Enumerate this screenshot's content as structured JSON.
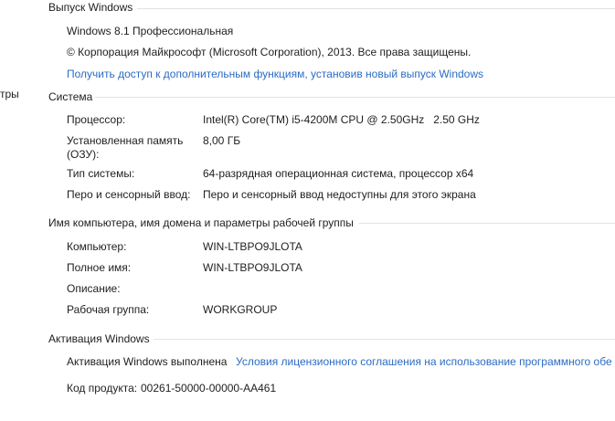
{
  "left_panel": {
    "partial_text": "тры"
  },
  "edition": {
    "section_title": "Выпуск Windows",
    "name": "Windows 8.1 Профессиональная",
    "copyright": "© Корпорация Майкрософт (Microsoft Corporation), 2013. Все права защищены.",
    "upgrade_link": "Получить доступ к дополнительным функциям, установив новый выпуск Windows"
  },
  "system": {
    "section_title": "Система",
    "processor_label": "Процессор:",
    "processor_value": "Intel(R) Core(TM) i5-4200M CPU @ 2.50GHz   2.50 GHz",
    "ram_label_line1": "Установленная память",
    "ram_label_line2": "(ОЗУ):",
    "ram_value": "8,00 ГБ",
    "type_label": "Тип системы:",
    "type_value": "64-разрядная операционная система, процессор x64",
    "pen_label": "Перо и сенсорный ввод:",
    "pen_value": "Перо и сенсорный ввод недоступны для этого экрана"
  },
  "computer": {
    "section_title": "Имя компьютера, имя домена и параметры рабочей группы",
    "computer_label": "Компьютер:",
    "computer_value": "WIN-LTBPO9JLOTA",
    "fullname_label": "Полное имя:",
    "fullname_value": "WIN-LTBPO9JLOTA",
    "description_label": "Описание:",
    "workgroup_label": "Рабочая группа:",
    "workgroup_value": "WORKGROUP"
  },
  "activation": {
    "section_title": "Активация Windows",
    "status": "Активация Windows выполнена",
    "license_link": "Условия лицензионного соглашения на использование программного обе",
    "product_id_label": "Код продукта:",
    "product_id_value": "00261-50000-00000-AA461"
  },
  "colors": {
    "link": "#2a6cc4",
    "text": "#1e1e1e",
    "divider": "#e3e3e3"
  }
}
